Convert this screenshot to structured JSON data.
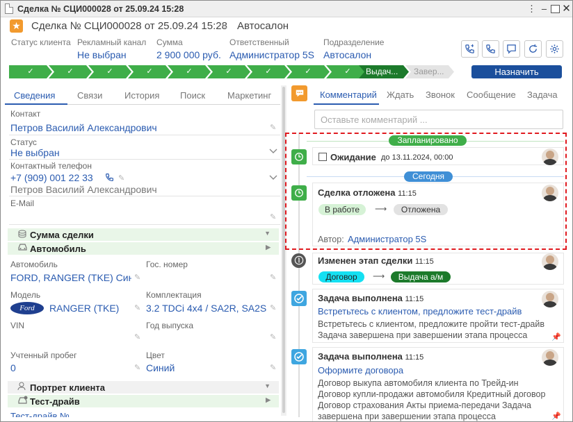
{
  "window": {
    "title": "Сделка № СЦИ000028 от 25.09.24 15:28"
  },
  "header": {
    "title": "Сделка № СЦИ000028 от 25.09.24 15:28",
    "subtitle": "Автосалон"
  },
  "info": [
    {
      "label": "Статус клиента",
      "value": ""
    },
    {
      "label": "Рекламный канал",
      "value": "Не выбран"
    },
    {
      "label": "Сумма",
      "value": "2 900 000 руб."
    },
    {
      "label": "Ответственный",
      "value": "Администратор 5S"
    },
    {
      "label": "Подразделение",
      "value": "Автосалон"
    }
  ],
  "stages": {
    "current": "Выдач...",
    "next": "Завер...",
    "completed_count": 9
  },
  "assign_button": "Назначить",
  "left_tabs": [
    "Сведения",
    "Связи",
    "История",
    "Поиск",
    "Маркетинг"
  ],
  "fields": {
    "contact_label": "Контакт",
    "contact_value": "Петров Василий Александрович",
    "status_label": "Статус",
    "status_value": "Не выбран",
    "phone_label": "Контактный телефон",
    "phone_value": "+7 (909) 001 22 33",
    "phone_owner": "Петров Василий Александрович",
    "email_label": "E-Mail",
    "email_value": ""
  },
  "groups": {
    "sum": "Сумма сделки",
    "car": "Автомобиль",
    "portrait": "Портрет клиента",
    "testdrive": "Тест-драйв"
  },
  "car": {
    "auto_label": "Автомобиль",
    "auto_value": "FORD, RANGER (TKE) Син",
    "gos_label": "Гос. номер",
    "gos_value": "",
    "model_label": "Модель",
    "model_brand": "Ford",
    "model_value": "RANGER (TKE)",
    "compl_label": "Комплектация",
    "compl_value": "3.2 TDCi 4x4 / SA2R, SA2S",
    "vin_label": "VIN",
    "year_label": "Год выпуска",
    "mileage_label": "Учтенный пробег",
    "mileage_value": "0",
    "color_label": "Цвет",
    "color_value": "Синий"
  },
  "bottom_partial": "Тест-драйв №",
  "right_tabs": [
    "Комментарий",
    "Ждать",
    "Звонок",
    "Сообщение",
    "Задача"
  ],
  "comment_placeholder": "Оставьте комментарий ...",
  "timeline": {
    "planned_label": "Запланировано",
    "today_label": "Сегодня",
    "items": [
      {
        "title": "Ожидание",
        "meta": "до 13.11.2024, 00:00"
      },
      {
        "title": "Сделка отложена",
        "time": "11:15",
        "from": "В работе",
        "to": "Отложена",
        "author_label": "Автор:",
        "author": "Администратор 5S"
      },
      {
        "title": "Изменен этап сделки",
        "time": "11:15",
        "from": "Договор",
        "to": "Выдача а/м"
      },
      {
        "title": "Задача выполнена",
        "time": "11:15",
        "link": "Встретьтесь с клиентом, предложите тест-драйв",
        "lines": [
          "Встретьтесь с клиентом, предложите пройти тест-драйв",
          "Задача завершена при завершении этапа процесса"
        ]
      },
      {
        "title": "Задача выполнена",
        "time": "11:15",
        "link": "Оформите договора",
        "lines": [
          "Договор выкупа автомобиля клиента по Трейд-ин",
          "Договор купли-продажи автомобиля Кредитный договор",
          "Договор страхования Акты приема-передачи Задача",
          "завершена при завершении этапа процесса"
        ]
      }
    ]
  },
  "colors": {
    "accent": "#2a5bb0",
    "stage": "#3fae49",
    "stage_current": "#1c7a2b",
    "orange": "#f29a2e",
    "highlight": "#e0191f"
  }
}
